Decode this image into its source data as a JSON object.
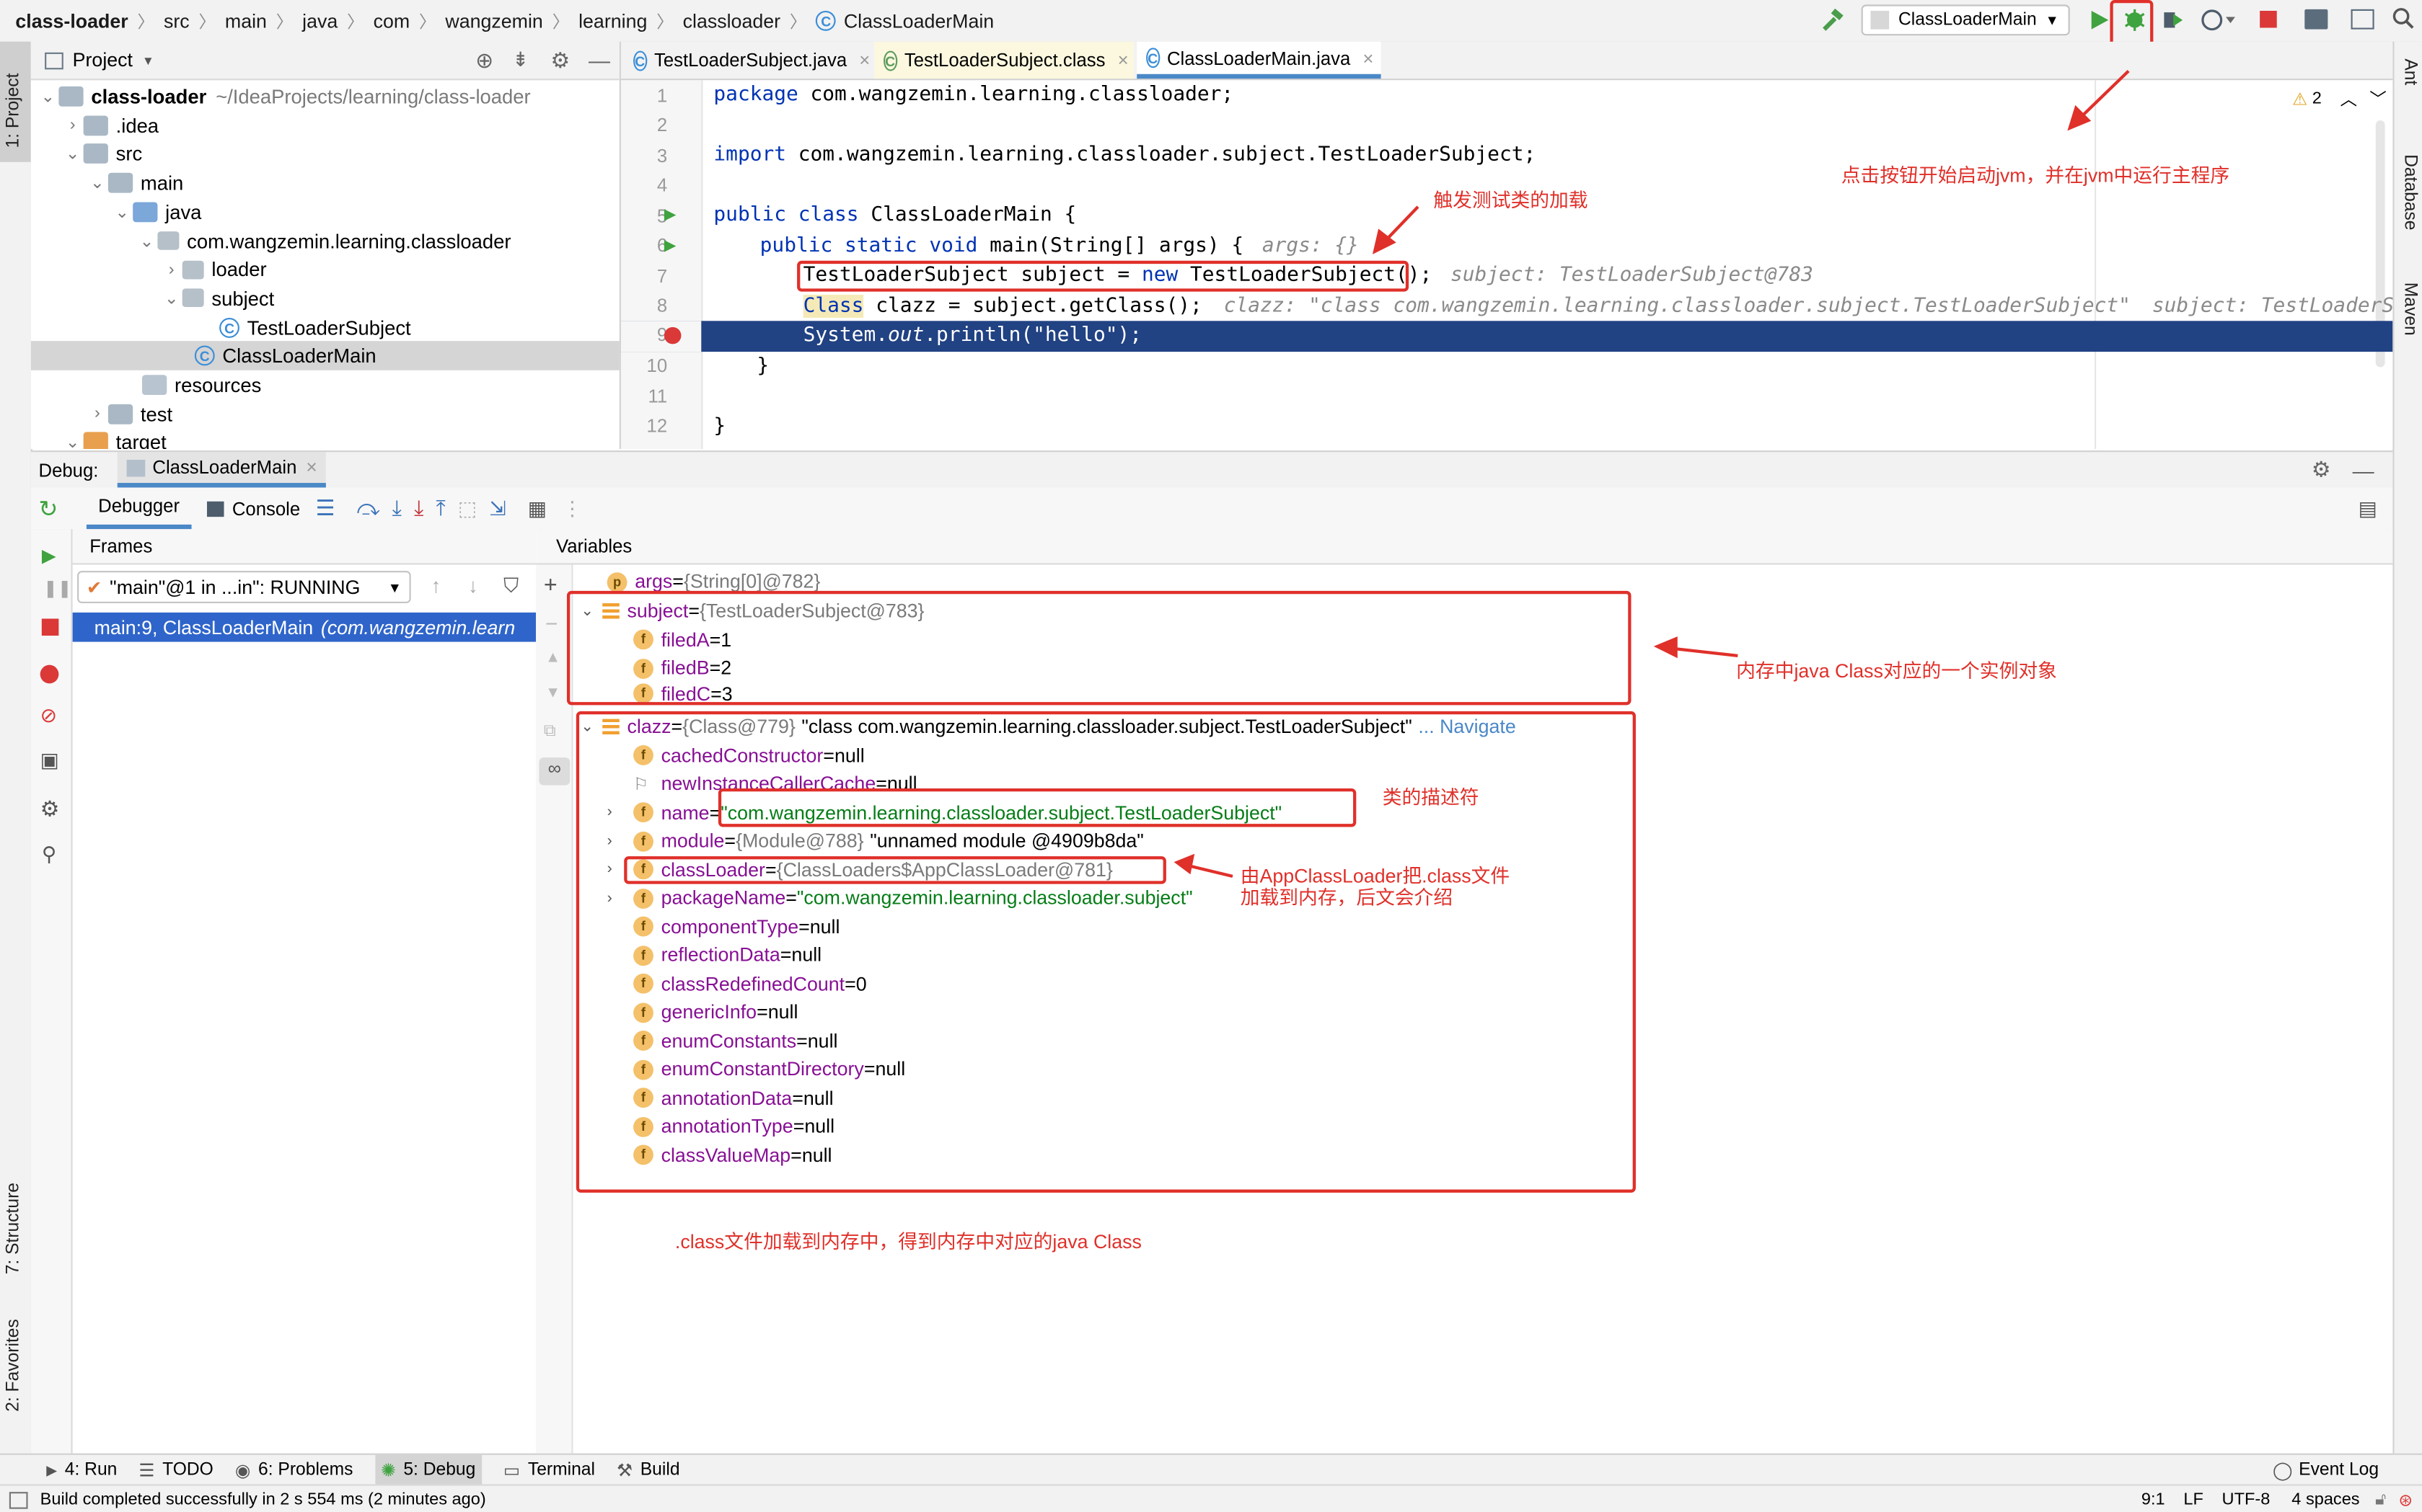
{
  "nav": {
    "crumbs": [
      "class-loader",
      "src",
      "main",
      "java",
      "com",
      "wangzemin",
      "learning",
      "classloader",
      "ClassLoaderMain"
    ],
    "run_config": "ClassLoaderMain"
  },
  "left_strip": {
    "project": "1: Project",
    "structure": "7: Structure",
    "favorites": "2: Favorites"
  },
  "right_strip": {
    "ant": "Ant",
    "database": "Database",
    "maven": "Maven"
  },
  "project": {
    "header": "Project",
    "root_label": "class-loader",
    "root_path": "~/IdeaProjects/learning/class-loader",
    "items": [
      ".idea",
      "src",
      "main",
      "java",
      "com.wangzemin.learning.classloader",
      "loader",
      "subject",
      "TestLoaderSubject",
      "ClassLoaderMain",
      "resources",
      "test",
      "target"
    ]
  },
  "editor": {
    "tabs": [
      "TestLoaderSubject.java",
      "TestLoaderSubject.class",
      "ClassLoaderMain.java"
    ],
    "warning_count": "2",
    "line_numbers": [
      "1",
      "2",
      "3",
      "4",
      "5",
      "6",
      "7",
      "8",
      "9",
      "10",
      "11",
      "12"
    ],
    "lines": {
      "l1_kw": "package",
      "l1_rest": " com.wangzemin.learning.classloader;",
      "l3_kw": "import",
      "l3_rest": " com.wangzemin.learning.classloader.subject.TestLoaderSubject;",
      "l5_kw": "public class",
      "l5_rest": " ClassLoaderMain {",
      "l6_kw": "public static void",
      "l6_rest": " main(String[] args) {",
      "l6_hint": "args: {}",
      "l7_a": "TestLoaderSubject subject = ",
      "l7_kw": "new",
      "l7_b": " TestLoaderSubject();",
      "l7_hint": "subject: TestLoaderSubject@783",
      "l8_a": "Class",
      "l8_b": " clazz = subject.getClass();",
      "l8_hint": "clazz: \"class com.wangzemin.learning.classloader.subject.TestLoaderSubject\"",
      "l8_hint2": "subject: TestLoaderSubject",
      "l9_a": "System.",
      "l9_b": "out",
      "l9_c": ".println(\"hello\");",
      "l10": "}",
      "l12": "}"
    }
  },
  "annotations": {
    "run_button": "点击按钮开始启动jvm，并在jvm中运行主程序",
    "trigger": "触发测试类的加载",
    "instance": "内存中java Class对应的一个实例对象",
    "descriptor": "类的描述符",
    "loader_line1": "由AppClassLoader把.class文件",
    "loader_line2": "加载到内存，后文会介绍",
    "summary": ".class文件加载到内存中，得到内存中对应的java Class"
  },
  "debug": {
    "label": "Debug:",
    "session": "ClassLoaderMain",
    "tabs": {
      "debugger": "Debugger",
      "console": "Console"
    },
    "frames_header": "Frames",
    "thread": "\"main\"@1 in ...in\": RUNNING",
    "frame": "main:9, ClassLoaderMain",
    "frame_pkg": "(com.wangzemin.learn",
    "variables_header": "Variables",
    "vars": {
      "args_name": "args",
      "args_val": "{String[0]@782}",
      "subject_name": "subject",
      "subject_val": "{TestLoaderSubject@783}",
      "filedA": "filedA",
      "filedA_val": "1",
      "filedB": "filedB",
      "filedB_val": "2",
      "filedC": "filedC",
      "filedC_val": "3",
      "clazz_name": "clazz",
      "clazz_ref": "{Class@779}",
      "clazz_val": "\"class com.wangzemin.learning.classloader.subject.TestLoaderSubject\"",
      "navigate": "... Navigate",
      "cachedConstructor": "cachedConstructor",
      "newInstanceCallerCache": "newInstanceCallerCache",
      "name": "name",
      "name_val": "\"com.wangzemin.learning.classloader.subject.TestLoaderSubject\"",
      "module": "module",
      "module_ref": "{Module@788}",
      "module_val": "\"unnamed module @4909b8da\"",
      "classLoader": "classLoader",
      "classLoader_val": "{ClassLoaders$AppClassLoader@781}",
      "packageName": "packageName",
      "packageName_val": "\"com.wangzemin.learning.classloader.subject\"",
      "componentType": "componentType",
      "reflectionData": "reflectionData",
      "classRedefinedCount": "classRedefinedCount",
      "classRedefinedCount_val": "0",
      "genericInfo": "genericInfo",
      "enumConstants": "enumConstants",
      "enumConstantDirectory": "enumConstantDirectory",
      "annotationData": "annotationData",
      "annotationType": "annotationType",
      "classValueMap": "classValueMap",
      "null": "null",
      "eq": " = "
    }
  },
  "bottom_tabs": {
    "run": "4: Run",
    "todo": "TODO",
    "problems": "6: Problems",
    "debug": "5: Debug",
    "terminal": "Terminal",
    "build": "Build",
    "event_log": "Event Log"
  },
  "status": {
    "message": "Build completed successfully in 2 s 554 ms (2 minutes ago)",
    "position": "9:1",
    "line_sep": "LF",
    "encoding": "UTF-8",
    "indent": "4 spaces"
  },
  "colors": {
    "accent_red": "#e0302a",
    "selection_blue": "#214283",
    "string_green": "#067d17"
  }
}
